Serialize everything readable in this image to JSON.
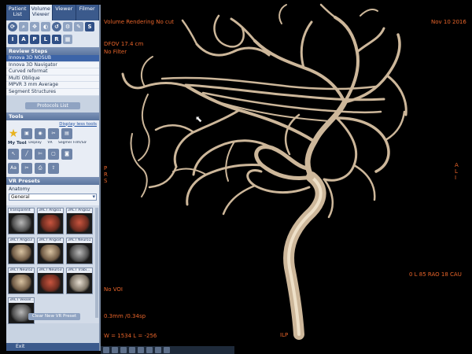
{
  "tabs": [
    "Patient List",
    "Volume Viewer",
    "Viewer",
    "Filmer"
  ],
  "toolbar_letters": [
    "S",
    "I",
    "A",
    "P",
    "L",
    "R"
  ],
  "review_steps": {
    "header": "Review Steps",
    "items": [
      "Innova 3D NOSUB",
      "Innova 3D Navigator",
      "Curved reformat",
      "Multi Oblique",
      "MPVR 3 mm Average",
      "Segment Structures"
    ],
    "protocols_button": "Protocols List"
  },
  "tools": {
    "header": "Tools",
    "display_less": "Display less tools",
    "labels": [
      "My Tools",
      "Display",
      "VR",
      "Segment",
      "Film/Save"
    ]
  },
  "vr_presets": {
    "header": "VR Presets",
    "anatomy_label": "Anatomy",
    "anatomy_value": "General",
    "items": [
      {
        "label": "Transparent",
        "thumb": "t-gray"
      },
      {
        "label": "3ACT Angio1",
        "thumb": "t-red"
      },
      {
        "label": "3ACT Angio2",
        "thumb": "t-red"
      },
      {
        "label": "3ACT Angio3",
        "thumb": "t-bone"
      },
      {
        "label": "3ACT Angio4",
        "thumb": "t-bone"
      },
      {
        "label": "3ACT Neuro1",
        "thumb": "t-gray"
      },
      {
        "label": "3ACT Neuro2",
        "thumb": "t-bone"
      },
      {
        "label": "3ACT Neuro3",
        "thumb": "t-red"
      },
      {
        "label": "3ACT Trabi...",
        "thumb": "t-pale"
      },
      {
        "label": "3ACT Vessel...",
        "thumb": "t-gray"
      }
    ],
    "clear_button": "Clear New VR Preset"
  },
  "exit_label": "Exit",
  "overlay": {
    "title": "Volume Rendering No cut",
    "date": "Nov 10 2016",
    "dfov": "DFOV 17.4 cm",
    "filter": "No Filter",
    "left_orient": "P\nR\nS",
    "right_orient": "A\nL\nI",
    "angle": "0 L 85 RAO 18 CAU",
    "voi": "No VOI",
    "slab": "0.3mm /0.34sp",
    "window": "W = 1534 L = -256",
    "bottom_orient": "ILP"
  },
  "colors": {
    "overlay_text": "#e8642a",
    "vessel": "#cdb79a",
    "panel_bg": "#c8d3e2",
    "selected_step": "#3c64a8"
  }
}
